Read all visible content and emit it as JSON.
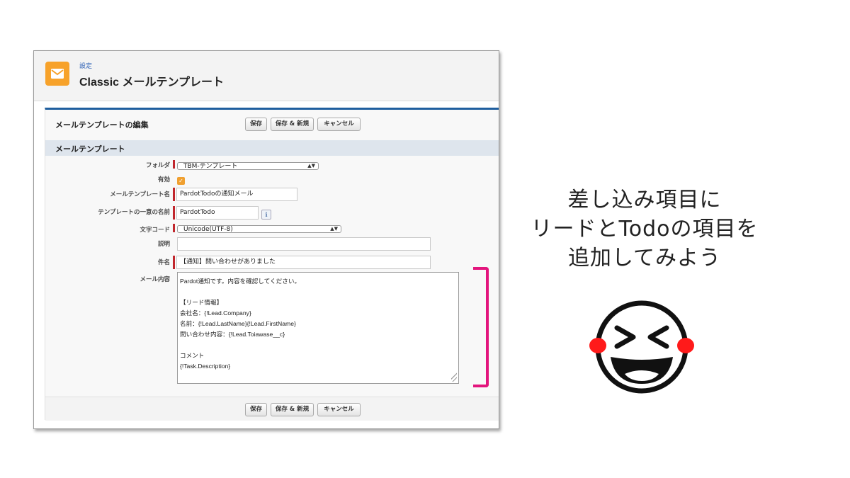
{
  "header": {
    "breadcrumb": "設定",
    "title": "Classic メールテンプレート"
  },
  "edit": {
    "title": "メールテンプレートの編集",
    "buttons": [
      "保存",
      "保存 & 新規",
      "キャンセル"
    ]
  },
  "section_title": "メールテンプレート",
  "fields": {
    "folder": {
      "label": "フォルダ",
      "value": "TBM-テンプレート"
    },
    "active": {
      "label": "有効",
      "checked": true
    },
    "template_name": {
      "label": "メールテンプレート名",
      "value": "PardotTodoの通知メール"
    },
    "unique_name": {
      "label": "テンプレートの一意の名前",
      "value": "PardotTodo"
    },
    "encoding": {
      "label": "文字コード",
      "value": "Unicode(UTF-8)"
    },
    "description": {
      "label": "説明",
      "value": ""
    },
    "subject": {
      "label": "件名",
      "value": "【通知】問い合わせがありました"
    },
    "body": {
      "label": "メール内容",
      "lines": [
        "Pardot通知です。内容を確認してください。",
        "",
        "【リード情報】",
        "会社名：{!Lead.Company}",
        "名前：{!Lead.LastName}{!Lead.FirstName}",
        "問い合わせ内容：{!Lead.Toiawase__c}",
        "",
        "コメント",
        "{!Task.Description}"
      ]
    }
  },
  "annotation": {
    "lines": [
      "差し込み項目に",
      "リードとTodoの項目を",
      "追加してみよう"
    ],
    "bracket_color": "#e3157d",
    "face_icon": "laughing-face-icon",
    "cheek_color": "#ff1a1a"
  },
  "colors": {
    "app_icon": "#f7a22a",
    "required": "#c1272d",
    "section_border": "#1f5e9e"
  }
}
